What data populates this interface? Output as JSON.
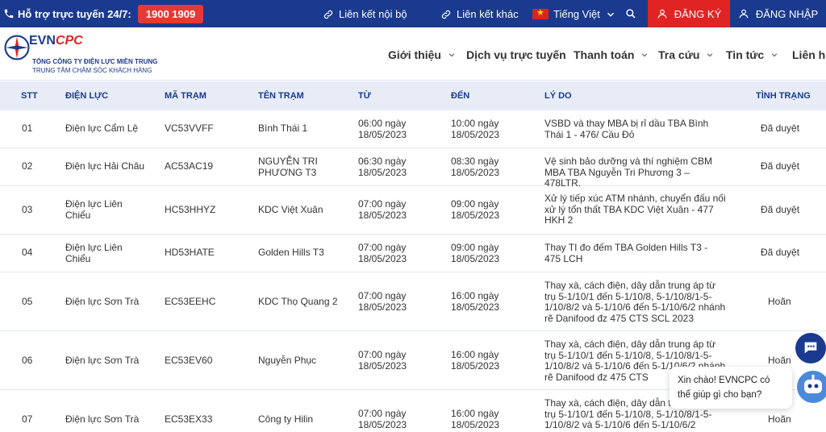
{
  "topbar": {
    "support_label": "Hỗ trợ trực tuyến 24/7:",
    "hotline": "1900 1909",
    "links": [
      "Liên kết nội bộ",
      "Liên kết khác"
    ],
    "language": "Tiếng Việt",
    "register": "ĐĂNG KÝ",
    "login": "ĐĂNG NHẬP",
    "colors": {
      "bar": "#1a3a8f",
      "accent": "#e02424"
    }
  },
  "logo": {
    "brand_a": "EVN",
    "brand_b": "CPC",
    "line1": "TỔNG CÔNG TY ĐIỆN LỰC MIỀN TRUNG",
    "line2": "TRUNG TÂM CHĂM SÓC KHÁCH HÀNG"
  },
  "nav": [
    "Giới thiệu",
    "Dịch vụ trực tuyến",
    "Thanh toán",
    "Tra cứu",
    "Tin tức",
    "Liên hệ"
  ],
  "table": {
    "headers": [
      "STT",
      "ĐIỆN LỰC",
      "MÃ TRẠM",
      "TÊN TRẠM",
      "TỪ",
      "ĐẾN",
      "LÝ DO",
      "TÌNH TRẠNG"
    ],
    "rows": [
      {
        "stt": "01",
        "dl": "Điện lực Cẩm Lệ",
        "ma": "VC53VVFF",
        "ten": "Bình Thái 1",
        "tu": "06:00 ngày 18/05/2023",
        "den": "10:00 ngày 18/05/2023",
        "lydo": "VSBD và thay MBA bị rỉ dầu TBA Bình Thái 1 - 476/ Cầu Đỏ",
        "tt": "Đã duyệt"
      },
      {
        "stt": "02",
        "dl": "Điện lực Hải Châu",
        "ma": "AC53AC19",
        "ten": "NGUYỄN TRI PHƯƠNG T3",
        "tu": "06:30 ngày 18/05/2023",
        "den": "08:30 ngày 18/05/2023",
        "lydo": "Vệ sinh bảo dưỡng và thí nghiệm CBM MBA TBA Nguyễn Tri Phương 3 – 478LTR.",
        "tt": "Đã duyệt"
      },
      {
        "stt": "03",
        "dl": "Điện lực Liên Chiểu",
        "ma": "HC53HHYZ",
        "ten": "KDC Việt Xuân",
        "tu": "07:00 ngày 18/05/2023",
        "den": "09:00 ngày 18/05/2023",
        "lydo": "Xử lý tiếp xúc ATM nhánh, chuyển đấu nối xử lý tổn thất TBA KDC Việt Xuân - 477 HKH 2",
        "tt": "Đã duyệt"
      },
      {
        "stt": "04",
        "dl": "Điện lực Liên Chiểu",
        "ma": "HD53HATE",
        "ten": "Golden Hills T3",
        "tu": "07:00 ngày 18/05/2023",
        "den": "09:00 ngày 18/05/2023",
        "lydo": "Thay TI đo đếm TBA Golden Hills T3 - 475 LCH",
        "tt": "Đã duyệt"
      },
      {
        "stt": "05",
        "dl": "Điện lực Sơn Trà",
        "ma": "EC53EEHC",
        "ten": "KDC Thọ Quang 2",
        "tu": "07:00 ngày 18/05/2023",
        "den": "16:00 ngày 18/05/2023",
        "lydo": "Thay xà, cách điện, dây dẫn trung áp từ trụ 5-1/10/1 đến 5-1/10/8, 5-1/10/8/1-5-1/10/8/2 và 5-1/10/6 đến 5-1/10/6/2 nhánh rẽ Danifood đz 475 CTS SCL 2023",
        "tt": "Hoãn"
      },
      {
        "stt": "06",
        "dl": "Điện lực Sơn Trà",
        "ma": "EC53EV60",
        "ten": "Nguyễn Phục",
        "tu": "07:00 ngày 18/05/2023",
        "den": "16:00 ngày 18/05/2023",
        "lydo": "Thay xà, cách điện, dây dẫn trung áp từ trụ 5-1/10/1 đến 5-1/10/8, 5-1/10/8/1-5-1/10/8/2 và 5-1/10/6 đến 5-1/10/6/2 nhánh rẽ Danifood đz 475 CTS",
        "tt": "Hoãn"
      },
      {
        "stt": "07",
        "dl": "Điện lực Sơn Trà",
        "ma": "EC53EX33",
        "ten": "Công ty Hilin",
        "tu": "07:00 ngày 18/05/2023",
        "den": "16:00 ngày 18/05/2023",
        "lydo": "Thay xà, cách điện, dây dẫn trung áp từ trụ 5-1/10/1 đến 5-1/10/8, 5-1/10/8/1-5-1/10/8/2 và 5-1/10/6 đến 5-1/10/6/2",
        "tt": "Hoãn"
      }
    ]
  },
  "chat": {
    "greeting": "Xin chào! EVNCPC có thể giúp gì cho bạn?"
  }
}
